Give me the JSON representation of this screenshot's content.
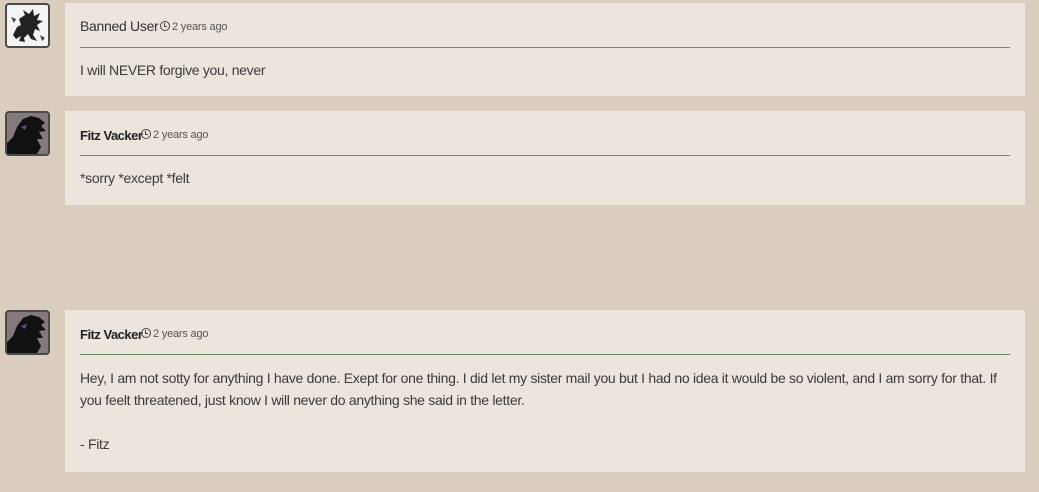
{
  "comments": [
    {
      "author": "Banned User",
      "time": "2 years ago",
      "avatar": "dragon-avatar-light",
      "body": [
        "I will NEVER forgive you, never"
      ]
    },
    {
      "author": "Fitz Vacker",
      "time": "2 years ago",
      "avatar": "dragon-avatar-dark",
      "body": [
        "*sorry *except *felt"
      ]
    },
    {
      "author": "Fitz Vacker",
      "time": "2 years ago",
      "avatar": "dragon-avatar-dark",
      "body": [
        "Hey, I am not sotty for anything I have done. Exept for one thing. I did let my sister mail you but I had no idea it would be so violent, and I am sorry for that. If you feelt threatened, just know I will never do anything she said in the letter.",
        "- Fitz"
      ]
    }
  ]
}
